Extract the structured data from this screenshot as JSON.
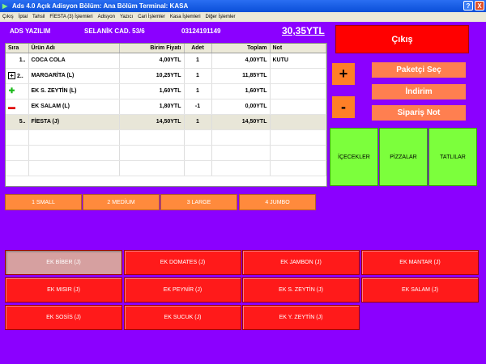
{
  "window": {
    "title": "Ads 4.0 Açık Adisyon Bölüm: Ana Bölüm Terminal: KASA",
    "help": "?",
    "close": "X"
  },
  "menu": [
    "Çıkış",
    "İptal",
    "Tahsil",
    "FİESTA (3) İşlemleri",
    "Adisyon",
    "Yazıcı",
    "Cari İşlemler",
    "Kasa İşlemleri",
    "Diğer İşlemler"
  ],
  "header": {
    "company": "ADS YAZILIM",
    "address": "SELANİK CAD. 53/6",
    "phone": "03124191149",
    "total": "30,35YTL"
  },
  "table": {
    "columns": [
      "Sıra",
      "Ürün Adı",
      "Birim Fiyatı",
      "Adet",
      "Toplam",
      "Not"
    ],
    "rows": [
      {
        "no": "1..",
        "mark": "",
        "name": "COCA COLA",
        "price": "4,00YTL",
        "qty": "1",
        "total": "4,00YTL",
        "note": "KUTU"
      },
      {
        "no": "2..",
        "mark": "plusbox",
        "name": "MARGARİTA (L)",
        "price": "10,25YTL",
        "qty": "1",
        "total": "11,85YTL",
        "note": ""
      },
      {
        "no": "",
        "mark": "green",
        "name": "EK S. ZEYTİN (L)",
        "price": "1,60YTL",
        "qty": "1",
        "total": "1,60YTL",
        "note": ""
      },
      {
        "no": "",
        "mark": "red",
        "name": "EK SALAM (L)",
        "price": "1,80YTL",
        "qty": "-1",
        "total": "0,00YTL",
        "note": ""
      },
      {
        "no": "5..",
        "mark": "",
        "name": "FİESTA (J)",
        "price": "14,50YTL",
        "qty": "1",
        "total": "14,50YTL",
        "note": ""
      }
    ]
  },
  "right": {
    "exit": "Çıkış",
    "plus": "+",
    "minus": "-",
    "package": "Paketçi Seç",
    "discount": "İndirim",
    "order_note": "Sipariş Not",
    "categories": [
      "İÇECEKLER",
      "PİZZALAR",
      "TATLILAR"
    ]
  },
  "sizes": [
    "1 SMALL",
    "2 MEDİUM",
    "3 LARGE",
    "4 JUMBO"
  ],
  "extras": [
    "EK BİBER (J)",
    "EK DOMATES (J)",
    "EK JAMBON (J)",
    "EK MANTAR (J)",
    "EK MISIR (J)",
    "EK PEYNİR (J)",
    "EK S. ZEYTİN (J)",
    "EK SALAM (J)",
    "EK SOSİS (J)",
    "EK SUCUK (J)",
    "EK Y. ZEYTİN (J)"
  ],
  "colors": {
    "background": "#8b00ff",
    "exit": "#ff0000",
    "orange": "#ff7f50",
    "category": "#7cff3c",
    "extra": "#ff1a1a"
  }
}
